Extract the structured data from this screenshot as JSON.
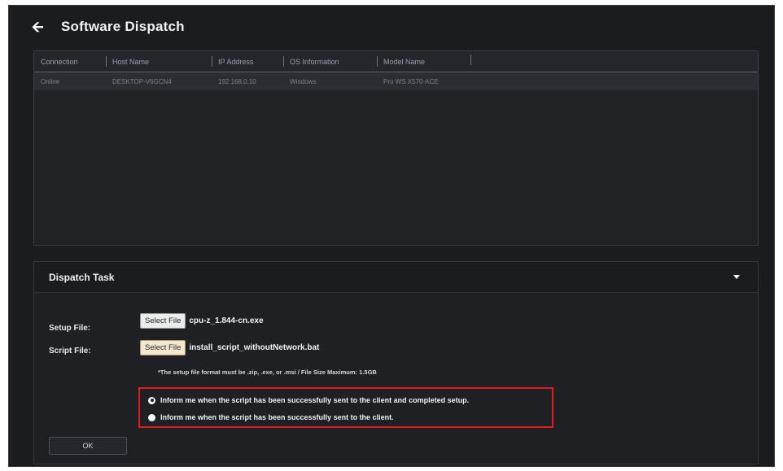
{
  "header": {
    "back_icon": "arrow-left-icon",
    "title": "Software Dispatch"
  },
  "table": {
    "columns": [
      "Connection",
      "Host Name",
      "IP Address",
      "OS Information",
      "Model Name"
    ],
    "rows": [
      [
        "Online",
        "DESKTOP-V6GCN4",
        "192.168.0.10",
        "Windows",
        "Pro WS X570-ACE"
      ]
    ]
  },
  "task": {
    "title": "Dispatch Task",
    "caret_icon": "caret-down-icon",
    "setup_label": "Setup File:",
    "script_label": "Script File:",
    "select_file_label": "Select File",
    "setup_file_name": "cpu-z_1.844-cn.exe",
    "script_file_name": "install_script_withoutNetwork.bat",
    "note": "*The setup file format must be .zip, .exe, or .msi  /  File Size Maximum: 1.5GB",
    "option_completed": "Inform me when the script has been successfully sent to the client and completed setup.",
    "option_sent": "Inform me when the script has been successfully sent to the client.",
    "selected_option": "completed",
    "ok_label": "OK"
  },
  "colors": {
    "window_bg": "#1b1c1e",
    "highlight_border": "#e01b1b"
  }
}
